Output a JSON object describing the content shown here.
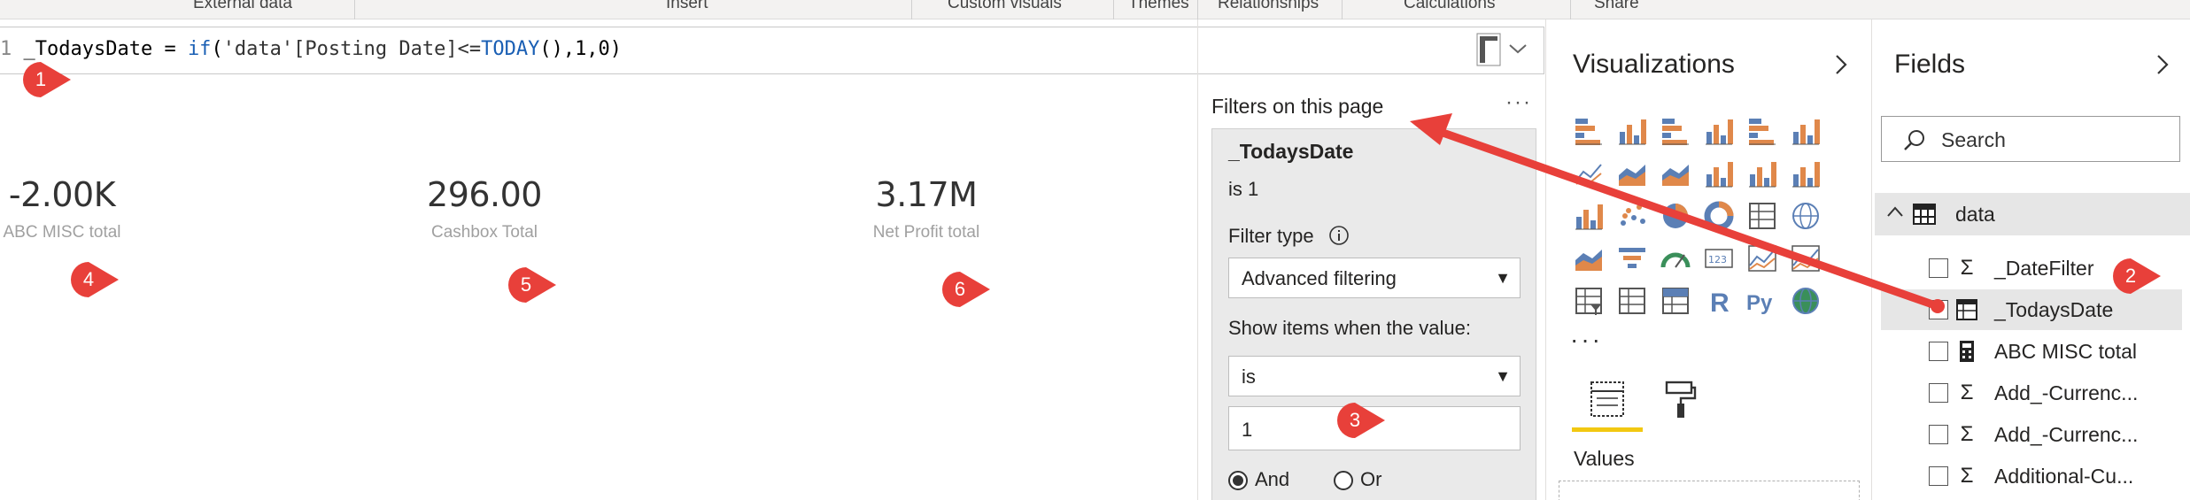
{
  "ribbon": {
    "groups": [
      "External data",
      "Insert",
      "Custom visuals",
      "Themes",
      "Relationships",
      "Calculations",
      "Share"
    ]
  },
  "formula": {
    "line_number": "1",
    "measure_name": "_TodaysDate = ",
    "func": "if",
    "open": "(",
    "arg": "'data'[Posting Date]<=",
    "today": "TODAY",
    "rest": "(),1,0)"
  },
  "cards": [
    {
      "value": "-2.00K",
      "label": "ABC MISC total"
    },
    {
      "value": "296.00",
      "label": "Cashbox Total"
    },
    {
      "value": "3.17M",
      "label": "Net Profit total"
    }
  ],
  "markers": [
    "1",
    "2",
    "3",
    "4",
    "5",
    "6"
  ],
  "marker_color": "#e8403a",
  "filters": {
    "title": "Filters on this page",
    "more": "···",
    "card_title": "_TodaysDate",
    "card_sub": "is 1",
    "type_label": "Filter type",
    "type_value": "Advanced filtering",
    "show_label": "Show items when the value:",
    "condition": "is",
    "value": "1",
    "and_label": "And",
    "or_label": "Or"
  },
  "visualizations": {
    "title": "Visualizations",
    "more": "···",
    "values_label": "Values",
    "text_icons": [
      "R",
      "Py"
    ],
    "accent": "#f2c811"
  },
  "fields": {
    "title": "Fields",
    "search_placeholder": "Search",
    "table_name": "data",
    "items": [
      {
        "name": "_DateFilter",
        "icon": "Σ"
      },
      {
        "name": "_TodaysDate",
        "icon": "⊞"
      },
      {
        "name": "ABC MISC total",
        "icon": "▦"
      },
      {
        "name": "Add_-Currenc...",
        "icon": "Σ"
      },
      {
        "name": "Add_-Currenc...",
        "icon": "Σ"
      },
      {
        "name": "Additional-Cu...",
        "icon": "Σ"
      }
    ]
  }
}
